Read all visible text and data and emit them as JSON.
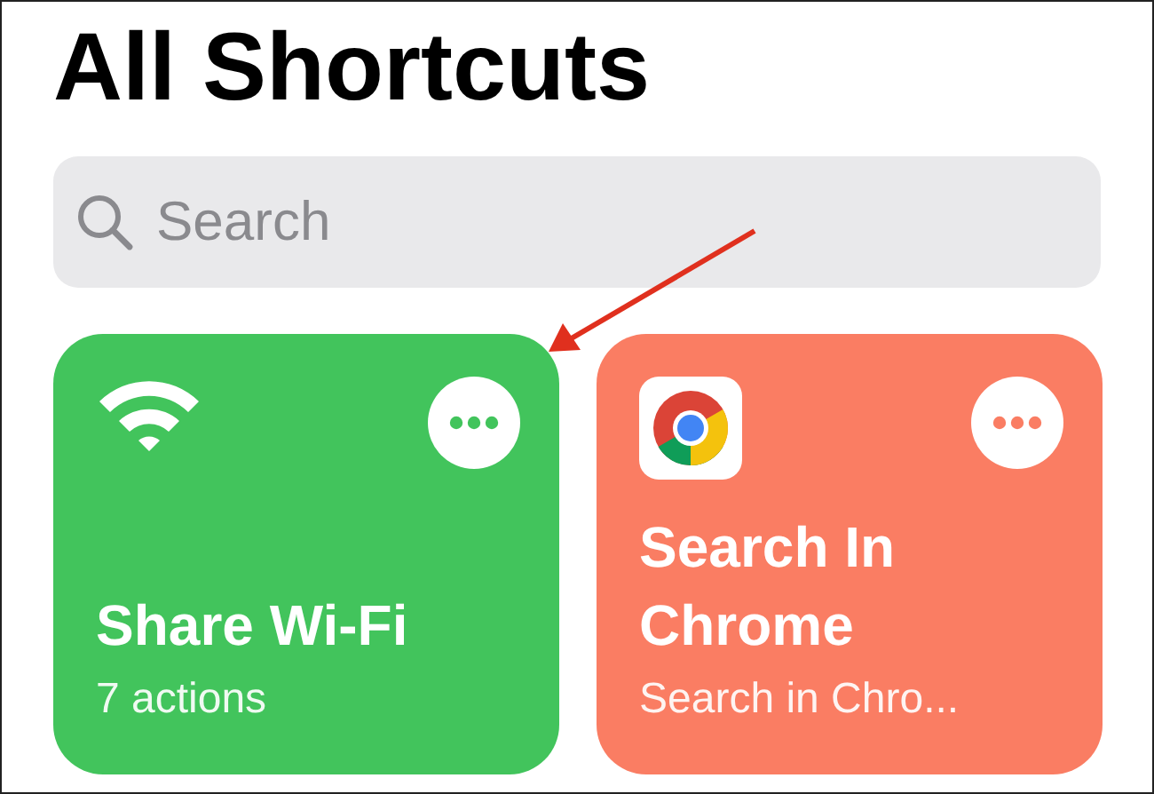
{
  "title": "All Shortcuts",
  "search": {
    "placeholder": "Search"
  },
  "shortcuts": [
    {
      "kind": "wifi",
      "name": "Share Wi-Fi",
      "subtitle": "7 actions",
      "color": "#42c45c"
    },
    {
      "kind": "app",
      "name": "Search In Chrome",
      "subtitle": "Search in Chro...",
      "color": "#fa7d63"
    }
  ]
}
